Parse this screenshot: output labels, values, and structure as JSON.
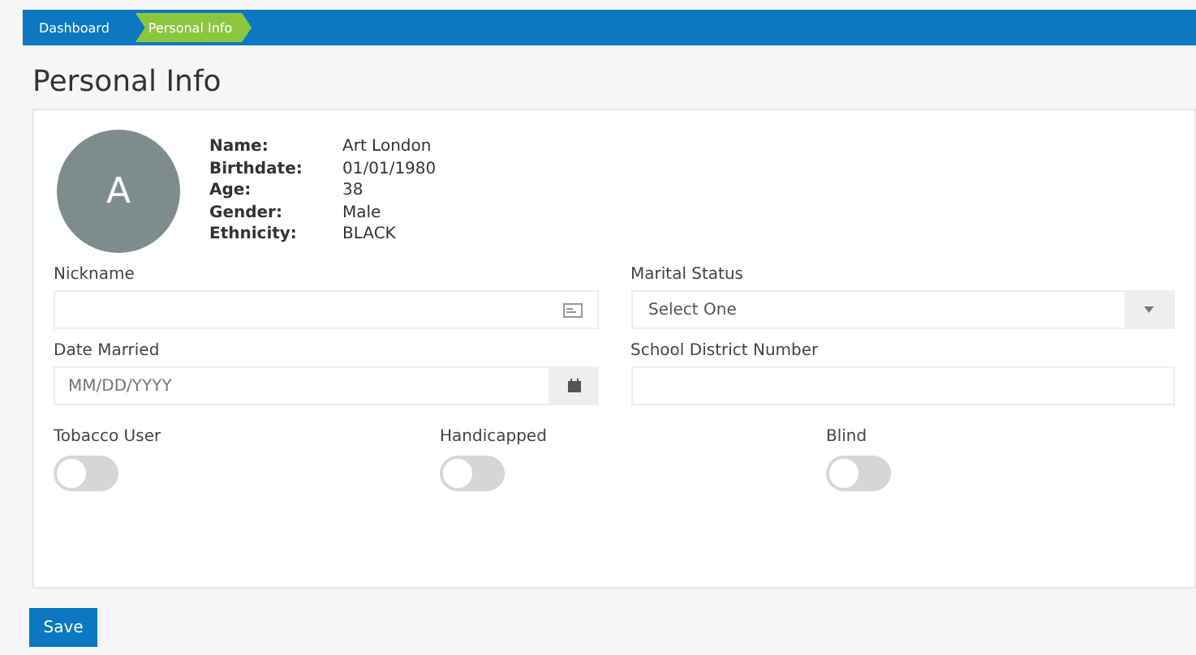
{
  "breadcrumbs": [
    {
      "label": "Dashboard",
      "selected": false
    },
    {
      "label": "Personal Info",
      "selected": true
    }
  ],
  "title": "Personal Info",
  "profile": {
    "avatar": "A",
    "details": [
      {
        "label": "Name:",
        "value": "Art London"
      },
      {
        "label": "Birthdate:",
        "value": "01/01/1980"
      },
      {
        "label": "Age:",
        "value": "38"
      },
      {
        "label": "Gender:",
        "value": "Male"
      },
      {
        "label": "Ethnicity:",
        "value": "BLACK"
      }
    ]
  },
  "fields": [
    {
      "kind": "text",
      "label": "Nickname"
    },
    {
      "kind": "select",
      "label": "Marital Status",
      "value": "Select One"
    },
    {
      "kind": "date",
      "label": "Date Married",
      "placeholder": "MM/DD/YYYY"
    },
    {
      "kind": "plain",
      "label": "School District Number"
    }
  ],
  "toggles": [
    {
      "label": "Tobacco User",
      "on": false
    },
    {
      "label": "Handicapped",
      "on": false
    },
    {
      "label": "Blind",
      "on": false
    }
  ],
  "buttons": [
    "Save"
  ]
}
